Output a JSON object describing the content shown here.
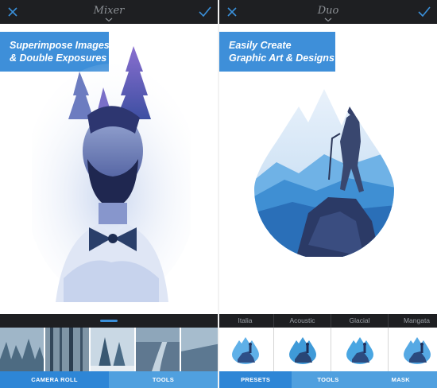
{
  "left": {
    "title": "Mixer",
    "callout": {
      "line1": "Superimpose Images",
      "line2": "& Double Exposures"
    },
    "tabs": [
      "CAMERA ROLL",
      "TOOLS"
    ],
    "active_tab": "CAMERA ROLL",
    "icons": [
      "close-icon",
      "check-icon",
      "chevron-down-icon"
    ]
  },
  "right": {
    "title": "Duo",
    "callout": {
      "line1": "Easily Create",
      "line2": "Graphic Art & Designs"
    },
    "presets": [
      "Italia",
      "Acoustic",
      "Glacial",
      "Mangata"
    ],
    "tabs": [
      "PRESETS",
      "TOOLS",
      "MASK"
    ],
    "active_tab": "PRESETS",
    "icons": [
      "close-icon",
      "check-icon",
      "chevron-down-icon"
    ]
  },
  "colors": {
    "topbar": "#1e1f22",
    "accent": "#3e8fd9",
    "tab_active": "#2e86d6",
    "tab_inactive": "#50a0df",
    "icon_blue": "#3a8fd8"
  }
}
